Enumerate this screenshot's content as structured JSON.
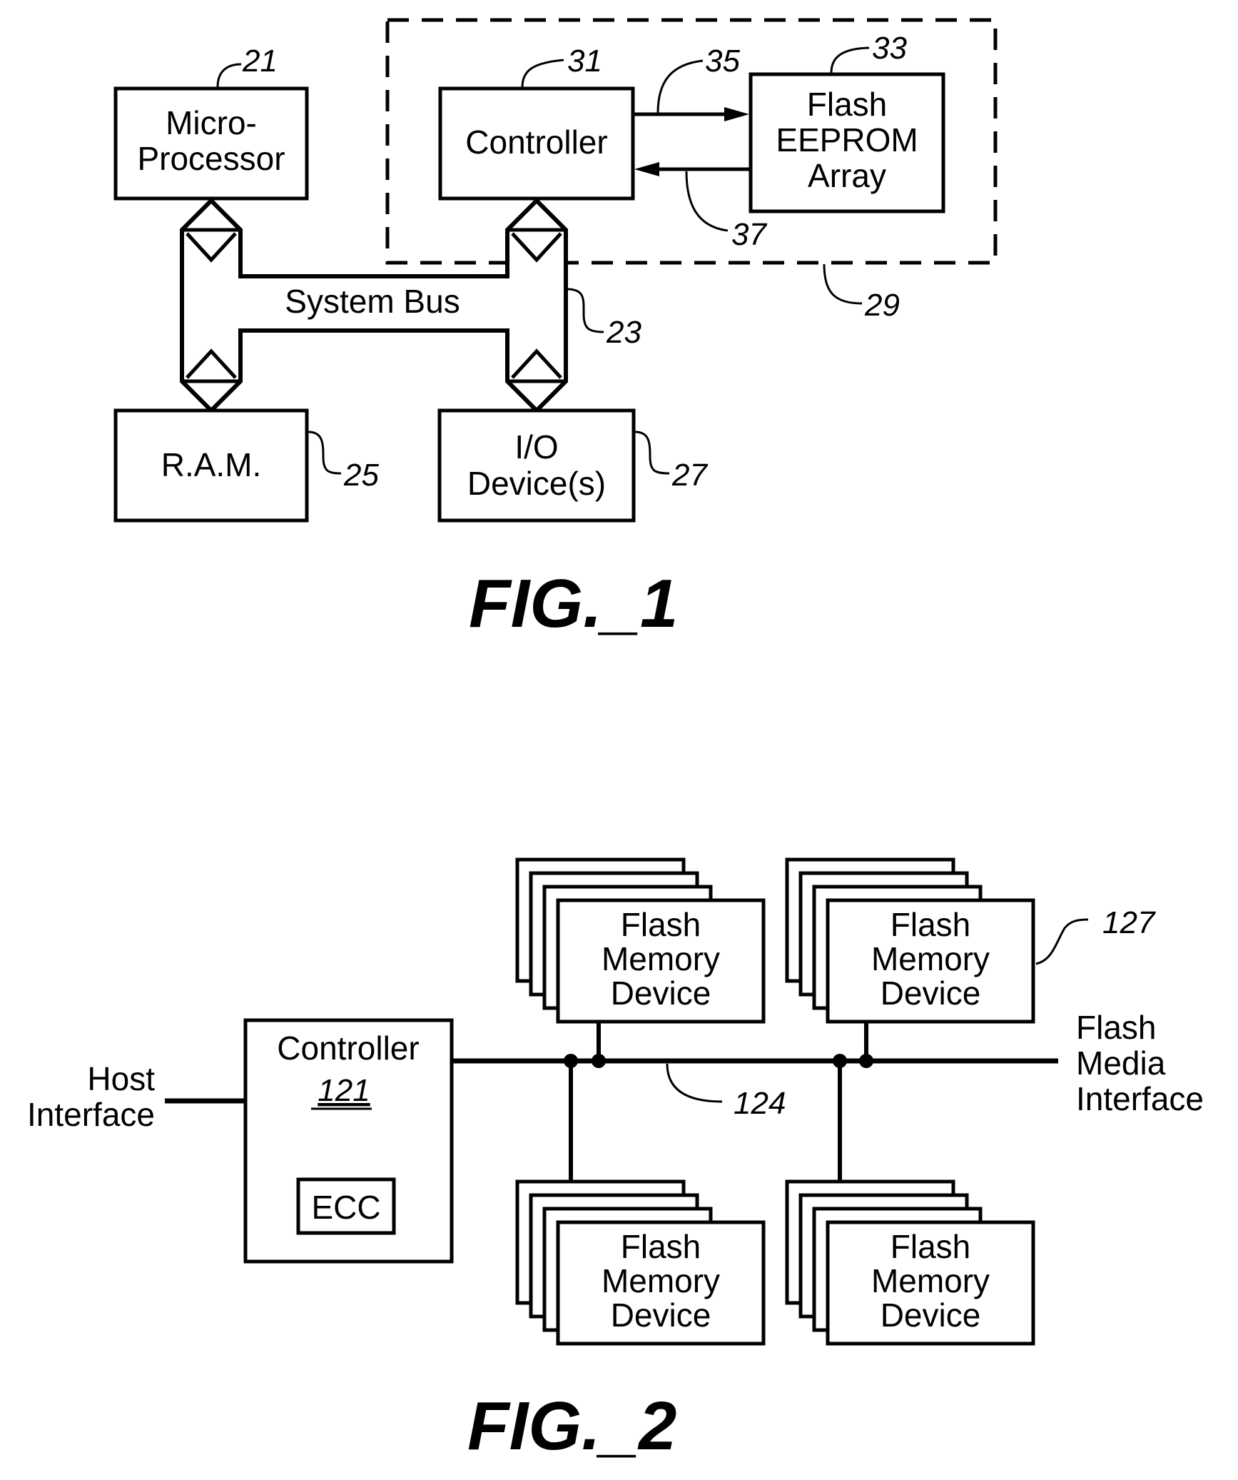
{
  "figure1": {
    "caption": "FIG._1",
    "blocks": {
      "microprocessor": {
        "lines": [
          "Micro-",
          "Processor"
        ],
        "ref": "21"
      },
      "controller": {
        "lines": [
          "Controller"
        ],
        "ref": "31"
      },
      "flash_eeprom": {
        "lines": [
          "Flash",
          "EEPROM",
          "Array"
        ],
        "ref": "33"
      },
      "ram": {
        "lines": [
          "R.A.M."
        ],
        "ref": "25"
      },
      "io_devices": {
        "lines": [
          "I/O",
          "Device(s)"
        ],
        "ref": "27"
      }
    },
    "system_bus": {
      "label": "System Bus",
      "ref": "23"
    },
    "memory_system_ref": "29",
    "signal_refs": {
      "to_array": "35",
      "from_array": "37"
    }
  },
  "figure2": {
    "caption": "FIG._2",
    "controller": {
      "label": "Controller",
      "ref": "121",
      "ecc_label": "ECC"
    },
    "host_interface": {
      "lines": [
        "Host",
        "Interface"
      ]
    },
    "flash_media_interface": {
      "lines": [
        "Flash",
        "Media",
        "Interface"
      ]
    },
    "bus_ref": "124",
    "device_ref": "127",
    "device_stacks": [
      {
        "position": "upper-left",
        "lines": [
          "Flash",
          "Memory",
          "Device"
        ]
      },
      {
        "position": "upper-right",
        "lines": [
          "Flash",
          "Memory",
          "Device"
        ]
      },
      {
        "position": "lower-left",
        "lines": [
          "Flash",
          "Memory",
          "Device"
        ]
      },
      {
        "position": "lower-right",
        "lines": [
          "Flash",
          "Memory",
          "Device"
        ]
      }
    ]
  }
}
